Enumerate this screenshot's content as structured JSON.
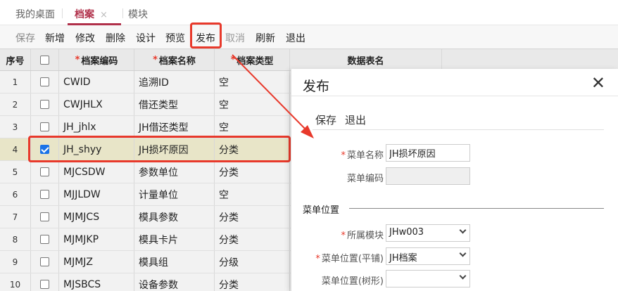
{
  "tabs": [
    {
      "label": "我的桌面"
    },
    {
      "label": "档案",
      "close": "×"
    },
    {
      "label": "模块"
    }
  ],
  "toolbar": {
    "save": "保存",
    "add": "新增",
    "edit": "修改",
    "delete": "删除",
    "design": "设计",
    "preview": "预览",
    "publish": "发布",
    "cancel": "取消",
    "refresh": "刷新",
    "exit": "退出"
  },
  "table": {
    "headers": {
      "no": "序号",
      "code": "档案编码",
      "name": "档案名称",
      "type": "档案类型",
      "table": "数据表名",
      "required_mark": "*"
    },
    "rows": [
      {
        "no": "1",
        "code": "CWID",
        "name": "追溯ID",
        "type": "空",
        "checked": false
      },
      {
        "no": "2",
        "code": "CWJHLX",
        "name": "借还类型",
        "type": "空",
        "checked": false
      },
      {
        "no": "3",
        "code": "JH_jhlx",
        "name": "JH借还类型",
        "type": "空",
        "checked": false
      },
      {
        "no": "4",
        "code": "JH_shyy",
        "name": "JH损坏原因",
        "type": "分类",
        "checked": true
      },
      {
        "no": "5",
        "code": "MJCSDW",
        "name": "参数单位",
        "type": "分类",
        "checked": false
      },
      {
        "no": "6",
        "code": "MJJLDW",
        "name": "计量单位",
        "type": "空",
        "checked": false
      },
      {
        "no": "7",
        "code": "MJMJCS",
        "name": "模具参数",
        "type": "分类",
        "checked": false
      },
      {
        "no": "8",
        "code": "MJMJKP",
        "name": "模具卡片",
        "type": "分类",
        "checked": false
      },
      {
        "no": "9",
        "code": "MJMJZ",
        "name": "模具组",
        "type": "分级",
        "checked": false
      },
      {
        "no": "10",
        "code": "MJSBCS",
        "name": "设备参数",
        "type": "分类",
        "checked": false
      }
    ]
  },
  "dialog": {
    "title": "发布",
    "close_icon": "✕",
    "save": "保存",
    "exit": "退出",
    "menu_name_label": "菜单名称",
    "menu_name_value": "JH损坏原因",
    "menu_code_label": "菜单编码",
    "menu_code_value": "",
    "section_title": "菜单位置",
    "module_label": "所属模块",
    "module_value": "JHw003",
    "flat_label": "菜单位置(平铺)",
    "flat_value": "JH档案",
    "tree_label": "菜单位置(树形)",
    "tree_value": ""
  },
  "colors": {
    "accent": "#b0304a",
    "annotation_red": "#e8392b",
    "checkbox_blue": "#1a73e8",
    "selected_row": "#e8e5c8"
  }
}
